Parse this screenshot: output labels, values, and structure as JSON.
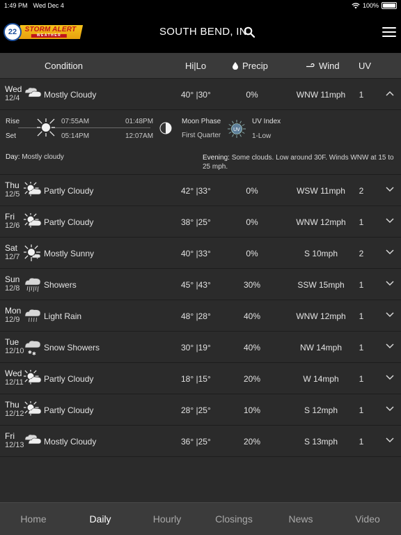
{
  "status_bar": {
    "time": "1:49 PM",
    "date": "Wed Dec 4",
    "battery": "100%"
  },
  "header": {
    "logo_number": "22",
    "logo_line1": "STORM ALERT",
    "logo_line2": "WEATHER",
    "location": "SOUTH BEND, IN"
  },
  "columns": {
    "condition": "Condition",
    "hilo": "Hi|Lo",
    "precip": "Precip",
    "wind": "Wind",
    "uv": "UV"
  },
  "days": [
    {
      "day": "Wed",
      "date": "12/4",
      "condition": "Mostly Cloudy",
      "icon": "mostly-cloudy-icon",
      "hilo": "40° |30°",
      "precip": "0%",
      "wind": "WNW 11mph",
      "uv": "1",
      "expanded": true
    },
    {
      "day": "Thu",
      "date": "12/5",
      "condition": "Partly Cloudy",
      "icon": "partly-cloudy-icon",
      "hilo": "42° |33°",
      "precip": "0%",
      "wind": "WSW 11mph",
      "uv": "2"
    },
    {
      "day": "Fri",
      "date": "12/6",
      "condition": "Partly Cloudy",
      "icon": "partly-cloudy-icon",
      "hilo": "38° |25°",
      "precip": "0%",
      "wind": "WNW 12mph",
      "uv": "1"
    },
    {
      "day": "Sat",
      "date": "12/7",
      "condition": "Mostly Sunny",
      "icon": "mostly-sunny-icon",
      "hilo": "40° |33°",
      "precip": "0%",
      "wind": "S 10mph",
      "uv": "2"
    },
    {
      "day": "Sun",
      "date": "12/8",
      "condition": "Showers",
      "icon": "showers-icon",
      "hilo": "45° |43°",
      "precip": "30%",
      "wind": "SSW 15mph",
      "uv": "1"
    },
    {
      "day": "Mon",
      "date": "12/9",
      "condition": "Light Rain",
      "icon": "light-rain-icon",
      "hilo": "48° |28°",
      "precip": "40%",
      "wind": "WNW 12mph",
      "uv": "1"
    },
    {
      "day": "Tue",
      "date": "12/10",
      "condition": "Snow Showers",
      "icon": "snow-showers-icon",
      "hilo": "30° |19°",
      "precip": "40%",
      "wind": "NW 14mph",
      "uv": "1"
    },
    {
      "day": "Wed",
      "date": "12/11",
      "condition": "Partly Cloudy",
      "icon": "partly-cloudy-icon",
      "hilo": "18° |15°",
      "precip": "20%",
      "wind": "W 14mph",
      "uv": "1"
    },
    {
      "day": "Thu",
      "date": "12/12",
      "condition": "Partly Cloudy",
      "icon": "partly-cloudy-icon",
      "hilo": "28° |25°",
      "precip": "10%",
      "wind": "S 12mph",
      "uv": "1"
    },
    {
      "day": "Fri",
      "date": "12/13",
      "condition": "Mostly Cloudy",
      "icon": "mostly-cloudy-icon",
      "hilo": "36° |25°",
      "precip": "20%",
      "wind": "S 13mph",
      "uv": "1"
    }
  ],
  "detail": {
    "rise_label": "Rise",
    "set_label": "Set",
    "sun_rise": "07:55AM",
    "sun_set": "05:14PM",
    "moon_rise": "01:48PM",
    "moon_set": "12:07AM",
    "moon_phase_label": "Moon Phase",
    "moon_phase_value": "First Quarter",
    "uv_icon_text": "UV",
    "uv_index_label": "UV Index",
    "uv_index_value": "1-Low",
    "day_label": "Day:",
    "day_text": "Mostly cloudy",
    "evening_label": "Evening:",
    "evening_text": "Some clouds. Low around 30F. Winds WNW at 15 to 25 mph."
  },
  "tabs": [
    {
      "label": "Home",
      "active": false
    },
    {
      "label": "Daily",
      "active": true
    },
    {
      "label": "Hourly",
      "active": false
    },
    {
      "label": "Closings",
      "active": false
    },
    {
      "label": "News",
      "active": false
    },
    {
      "label": "Video",
      "active": false
    }
  ]
}
